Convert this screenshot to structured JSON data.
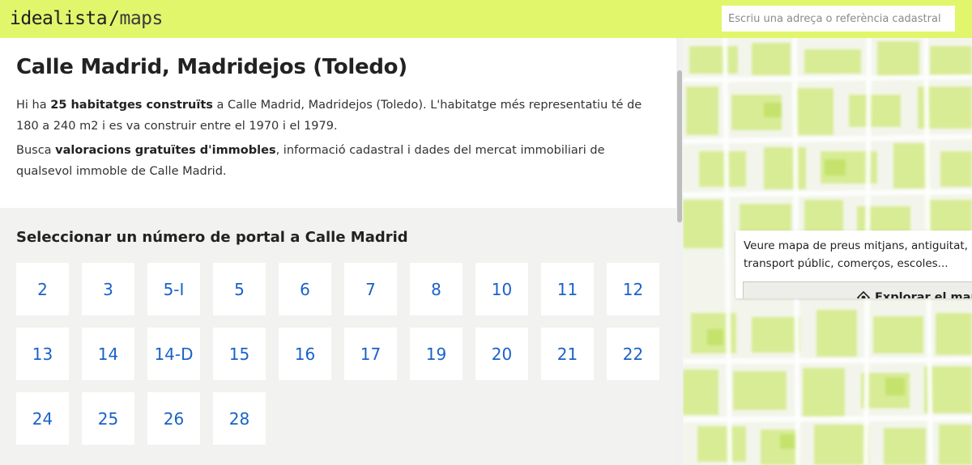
{
  "header": {
    "logo_main": "idealista",
    "logo_slash": "/",
    "logo_suffix": "maps",
    "search_placeholder": "Escriu una adreça o referència cadastral"
  },
  "street": {
    "title": "Calle Madrid, Madridejos (Toledo)",
    "desc1_pre": "Hi ha ",
    "desc1_bold": "25 habitatges construïts",
    "desc1_post": " a Calle Madrid, Madridejos (Toledo). L'habitatge més representatiu té de 180 a 240 m2 i es va construir entre el 1970 i el 1979.",
    "desc2_pre": "Busca ",
    "desc2_bold": "valoracions gratuïtes d'immobles",
    "desc2_post": ", informació cadastral i dades del mercat immobiliari de qualsevol immoble de Calle Madrid."
  },
  "portals": {
    "title": "Seleccionar un número de portal a Calle Madrid",
    "numbers": [
      "2",
      "3",
      "5-I",
      "5",
      "6",
      "7",
      "8",
      "10",
      "11",
      "12",
      "13",
      "14",
      "14-D",
      "15",
      "16",
      "17",
      "19",
      "20",
      "21",
      "22",
      "24",
      "25",
      "26",
      "28"
    ]
  },
  "map_card": {
    "line1": "Veure mapa de preus mitjans, antiguitat,",
    "line2": "transport públic, comerços, escoles...",
    "button_label": "Explorar el mapa"
  },
  "colors": {
    "accent": "#e1f66b",
    "link": "#1a62c8",
    "map_green": "#d4ec7e"
  }
}
